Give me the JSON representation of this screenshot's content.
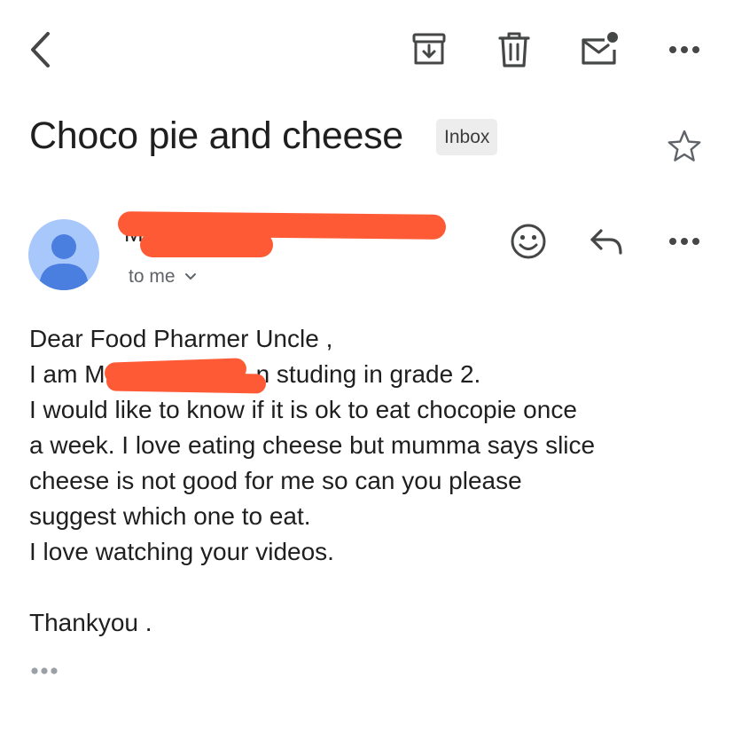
{
  "toolbar": {
    "back": "back-arrow-icon",
    "archive": "archive-icon",
    "delete": "trash-icon",
    "mark_unread": "mark-unread-icon",
    "more": "more-horizontal-icon"
  },
  "email": {
    "subject": "Choco pie and cheese",
    "label": "Inbox",
    "sender_initial": "M",
    "recipient_text": "to me",
    "body": {
      "line1": "Dear Food Pharmer Uncle ,",
      "line2_prefix": "I am M",
      "line2_suffix": "n studing in grade 2.",
      "line3": "I would like to know if it is ok to  eat chocopie once",
      "line4": "a week. I love eating cheese but mumma says slice",
      "line5": "cheese is not good for me so can you please",
      "line6": "suggest which one to eat.",
      "line7": "I love watching your videos.",
      "signoff": "Thankyou ."
    }
  },
  "colors": {
    "avatar_bg": "#a8c7fa",
    "avatar_fg": "#4a7fe0",
    "redaction": "#ff5a36",
    "icon": "#444746",
    "badge_bg": "#ededed"
  }
}
